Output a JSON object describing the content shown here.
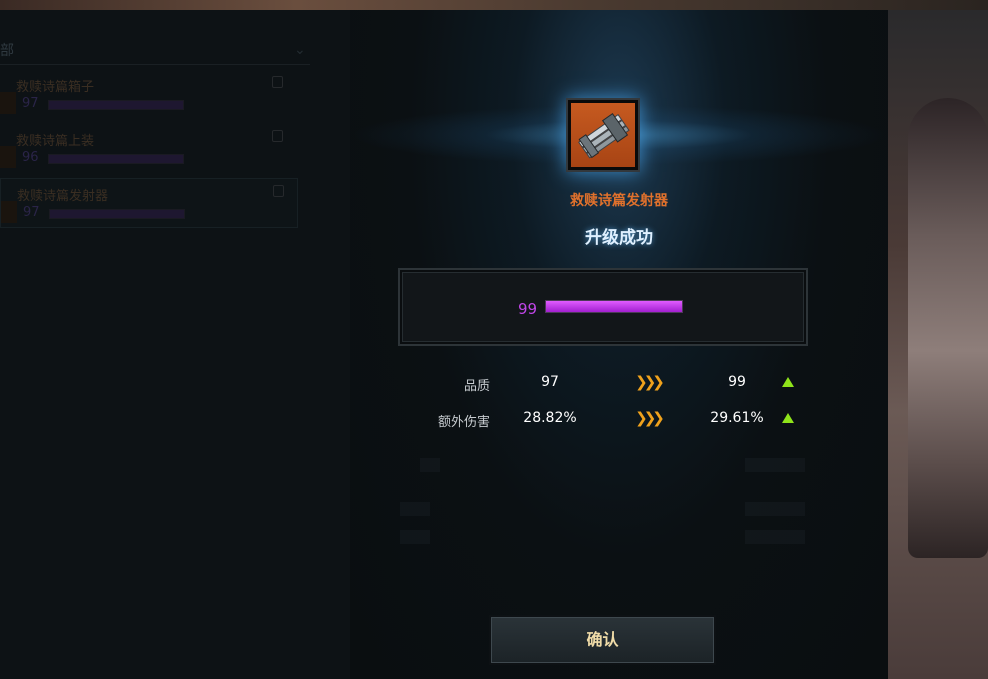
{
  "left_panel": {
    "header": "部",
    "items": [
      {
        "name": "救赎诗篇箱子",
        "level": "97"
      },
      {
        "name": "救赎诗篇上装",
        "level": "96"
      },
      {
        "name": "救赎诗篇发射器",
        "level": "97"
      }
    ]
  },
  "dialog": {
    "item_name": "救赎诗篇发射器",
    "title": "升级成功",
    "level": "99",
    "level_progress": 1.0,
    "stats": [
      {
        "label": "品质",
        "old": "97",
        "arrow": "❯❯❯",
        "new": "99"
      },
      {
        "label": "额外伤害",
        "old": "28.82%",
        "arrow": "❯❯❯",
        "new": "29.61%"
      }
    ],
    "confirm_label": "确认"
  },
  "colors": {
    "item_name": "#e0712c",
    "level_bar": "#c046e8",
    "up_arrow": "#8fe31a",
    "arrow": "#f0a21c"
  }
}
